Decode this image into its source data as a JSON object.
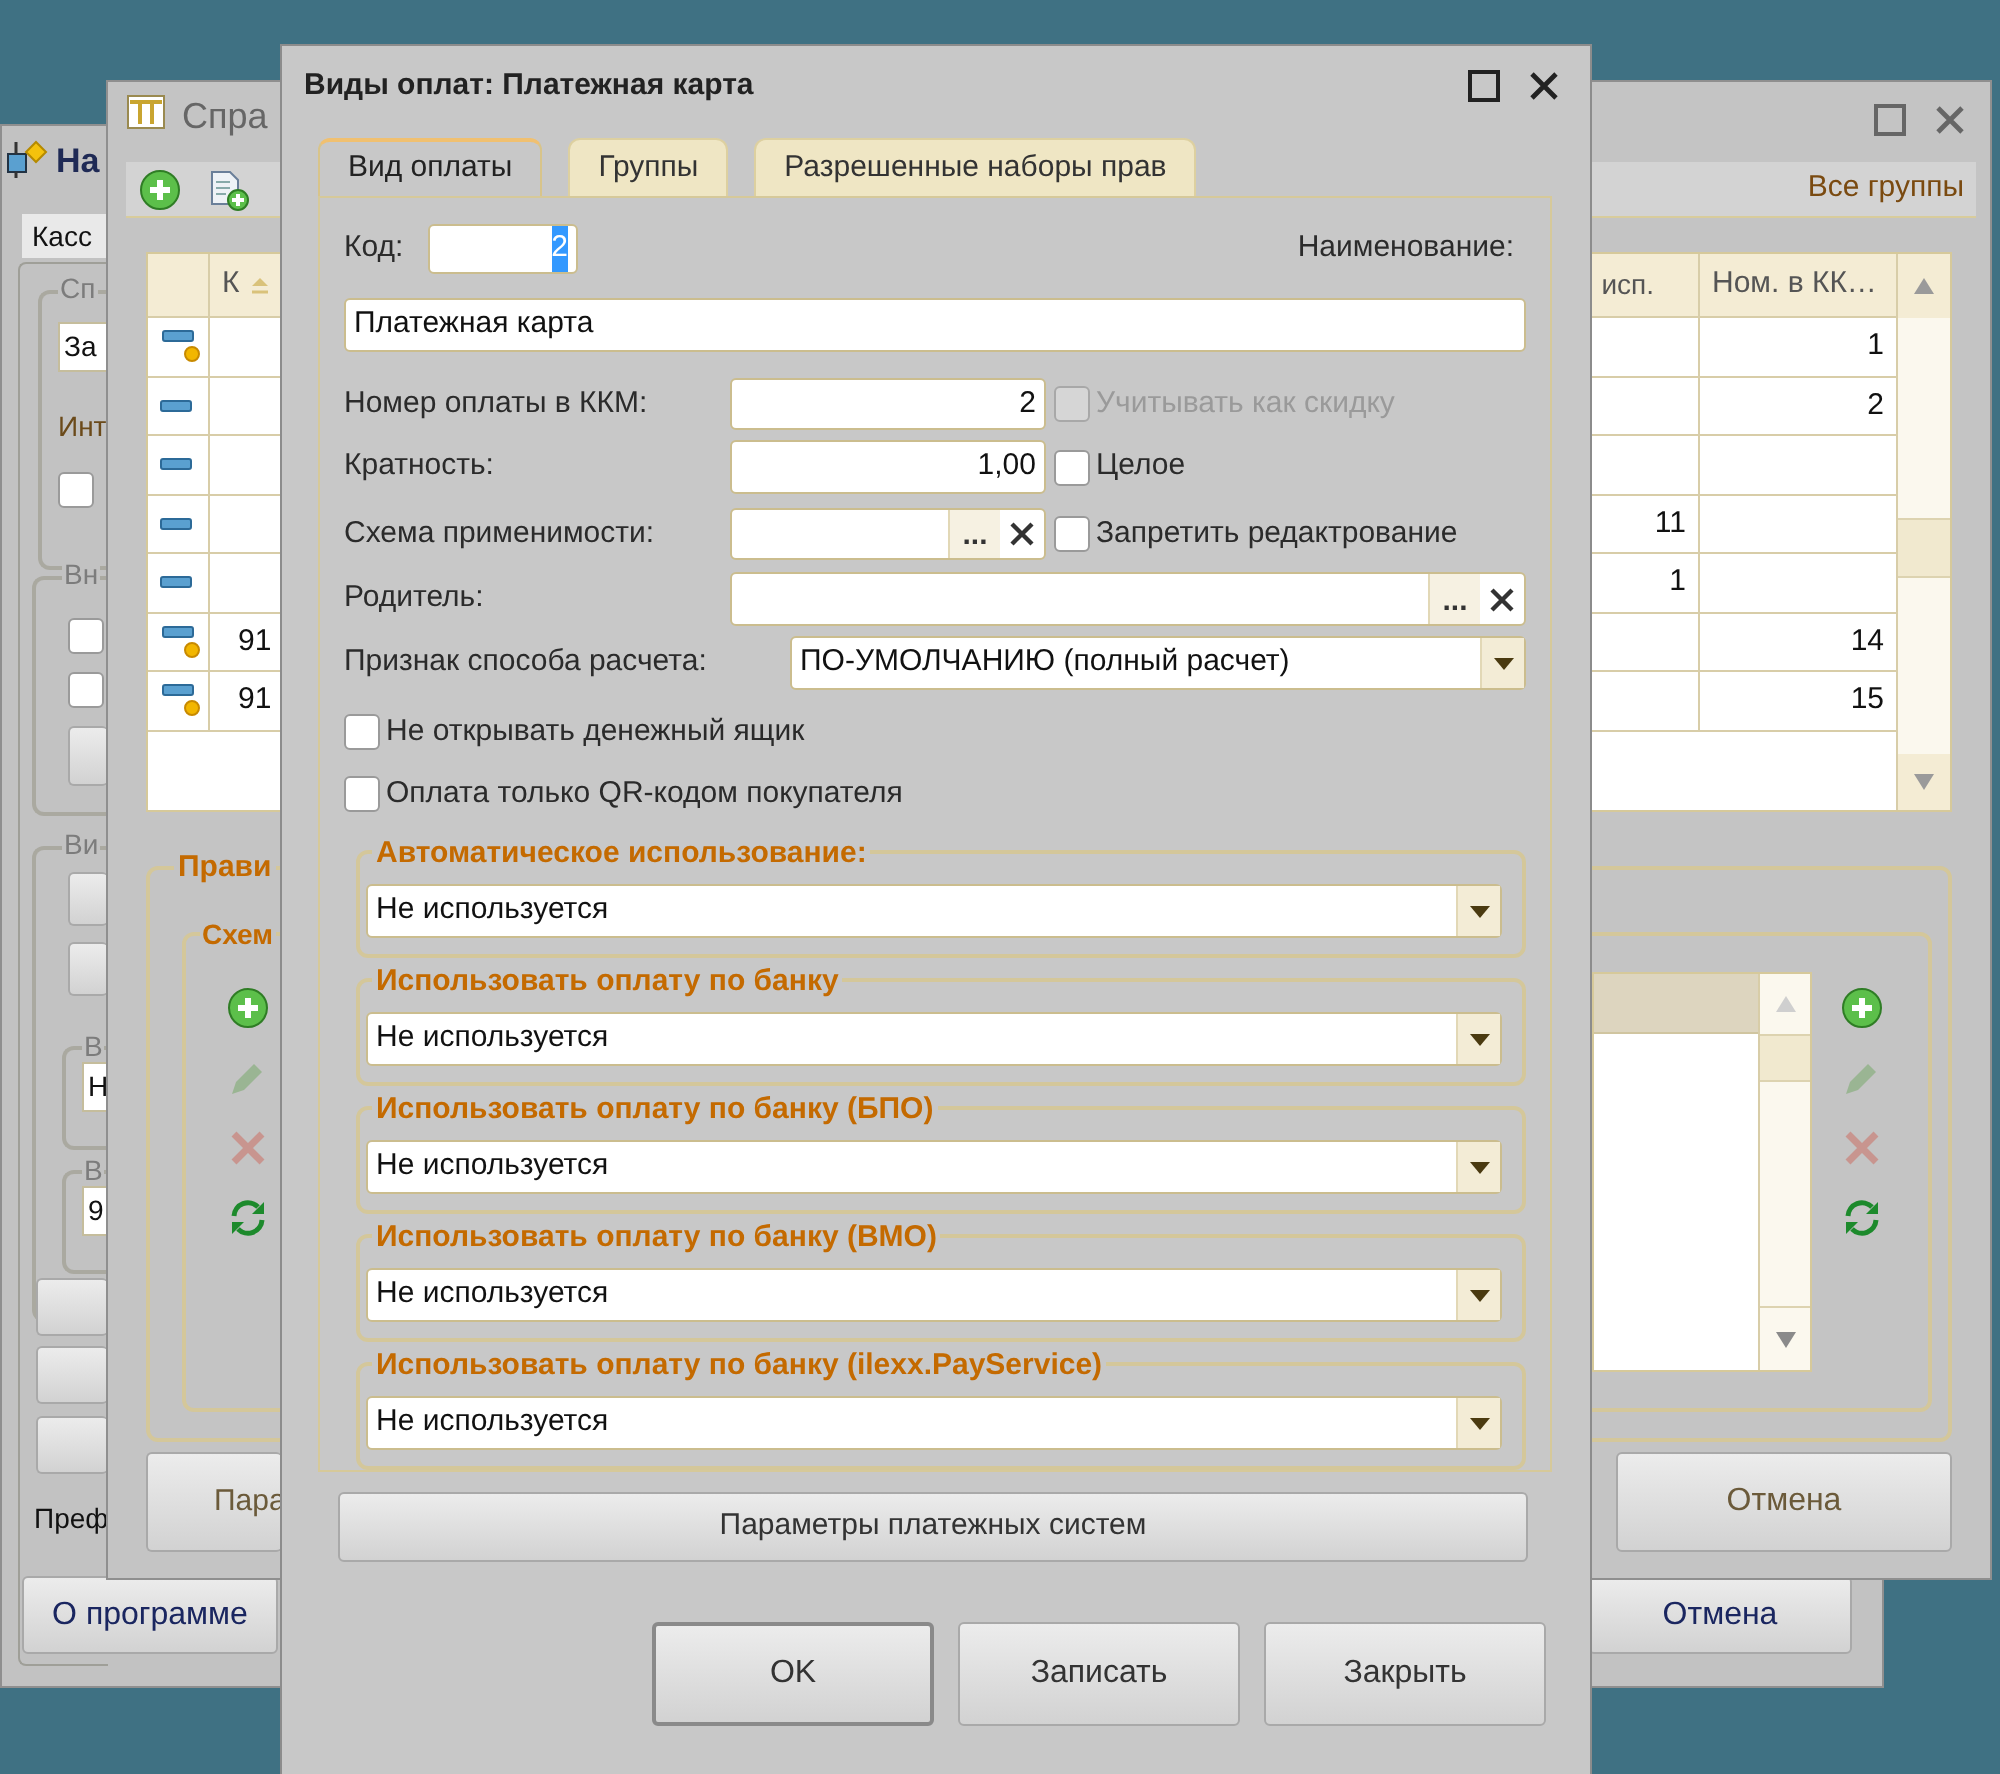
{
  "back_window": {
    "title": "На",
    "tab": "Касс",
    "group_labels": [
      "Сп",
      "Вн",
      "Ви",
      "В",
      "В"
    ],
    "fields": [
      "За",
      "Н",
      "9"
    ],
    "labels": [
      "Инт",
      "Преф"
    ],
    "checkboxes": [
      {
        "checked": false
      },
      {
        "checked": false
      },
      {
        "checked": false
      }
    ],
    "buttons": [
      "О программе",
      "Отмена"
    ]
  },
  "list_window": {
    "title": "Спра",
    "filter_link": "Все группы",
    "table": {
      "columns": [
        "К",
        "исп.",
        "Ном. в КК…"
      ],
      "rows": [
        {
          "kind": "marked",
          "nom": "1"
        },
        {
          "kind": "plain",
          "nom": "2"
        },
        {
          "kind": "plain"
        },
        {
          "kind": "plain",
          "isp": "11"
        },
        {
          "kind": "plain",
          "isp": "1"
        },
        {
          "kind": "marked",
          "k": "91",
          "nom": "14"
        },
        {
          "kind": "marked",
          "k": "91",
          "nom": "15"
        }
      ]
    },
    "group": "Прави",
    "subgroup": "Схем",
    "commands_left": [
      {
        "kind": "add",
        "disabled": false
      },
      {
        "kind": "edit",
        "disabled": true
      },
      {
        "kind": "delete",
        "disabled": true
      },
      {
        "kind": "refresh",
        "disabled": false
      }
    ],
    "commands_right": [
      {
        "kind": "add",
        "disabled": false
      },
      {
        "kind": "edit",
        "disabled": true
      },
      {
        "kind": "delete",
        "disabled": true
      },
      {
        "kind": "refresh",
        "disabled": false
      }
    ],
    "buttons": [
      "Пара",
      "Отмена"
    ]
  },
  "dialog": {
    "title": "Виды оплат: Платежная карта",
    "tabs": [
      {
        "label": "Вид оплаты",
        "selected": true
      },
      {
        "label": "Группы",
        "selected": false
      },
      {
        "label": "Разрешенные наборы прав",
        "selected": false
      }
    ],
    "code": {
      "label": "Код:",
      "value": "2",
      "value_selected": true
    },
    "name": {
      "label": "Наименование:",
      "value": "Платежная карта"
    },
    "fields": [
      {
        "kind": "number",
        "label": "Номер оплаты в ККМ:",
        "value": "2",
        "checkbox": {
          "label": "Учитывать как скидку",
          "checked": false,
          "disabled": true
        }
      },
      {
        "kind": "number",
        "label": "Кратность:",
        "value": "1,00",
        "checkbox": {
          "label": "Целое",
          "checked": false,
          "disabled": false
        }
      },
      {
        "kind": "choice",
        "label": "Схема применимости:",
        "select_label": "...",
        "checkbox": {
          "label": "Запретить редактрование",
          "checked": false,
          "disabled": false
        }
      },
      {
        "kind": "choice_wide",
        "label": "Родитель:",
        "select_label": "..."
      },
      {
        "kind": "dropdown",
        "label": "Признак способа расчета:",
        "value": "ПО-УМОЛЧАНИЮ (полный расчет)"
      }
    ],
    "options": [
      {
        "label": "Не открывать денежный ящик",
        "checked": false
      },
      {
        "label": "Оплата только QR-кодом покупателя",
        "checked": false
      }
    ],
    "bank_groups": [
      {
        "title": "Автоматическое использование:",
        "value": "Не используется"
      },
      {
        "title": "Использовать оплату по банку",
        "value": "Не используется"
      },
      {
        "title": "Использовать оплату по банку (БПО)",
        "value": "Не используется"
      },
      {
        "title": "Использовать оплату по банку (ВМО)",
        "value": "Не используется"
      },
      {
        "title": "Использовать оплату по банку (ilexx.PayService)",
        "value": "Не используется"
      }
    ],
    "settings_button": "Параметры платежных систем",
    "buttons": [
      {
        "label": "OK",
        "default": true
      },
      {
        "label": "Записать",
        "default": false
      },
      {
        "label": "Закрыть",
        "default": false
      }
    ]
  }
}
